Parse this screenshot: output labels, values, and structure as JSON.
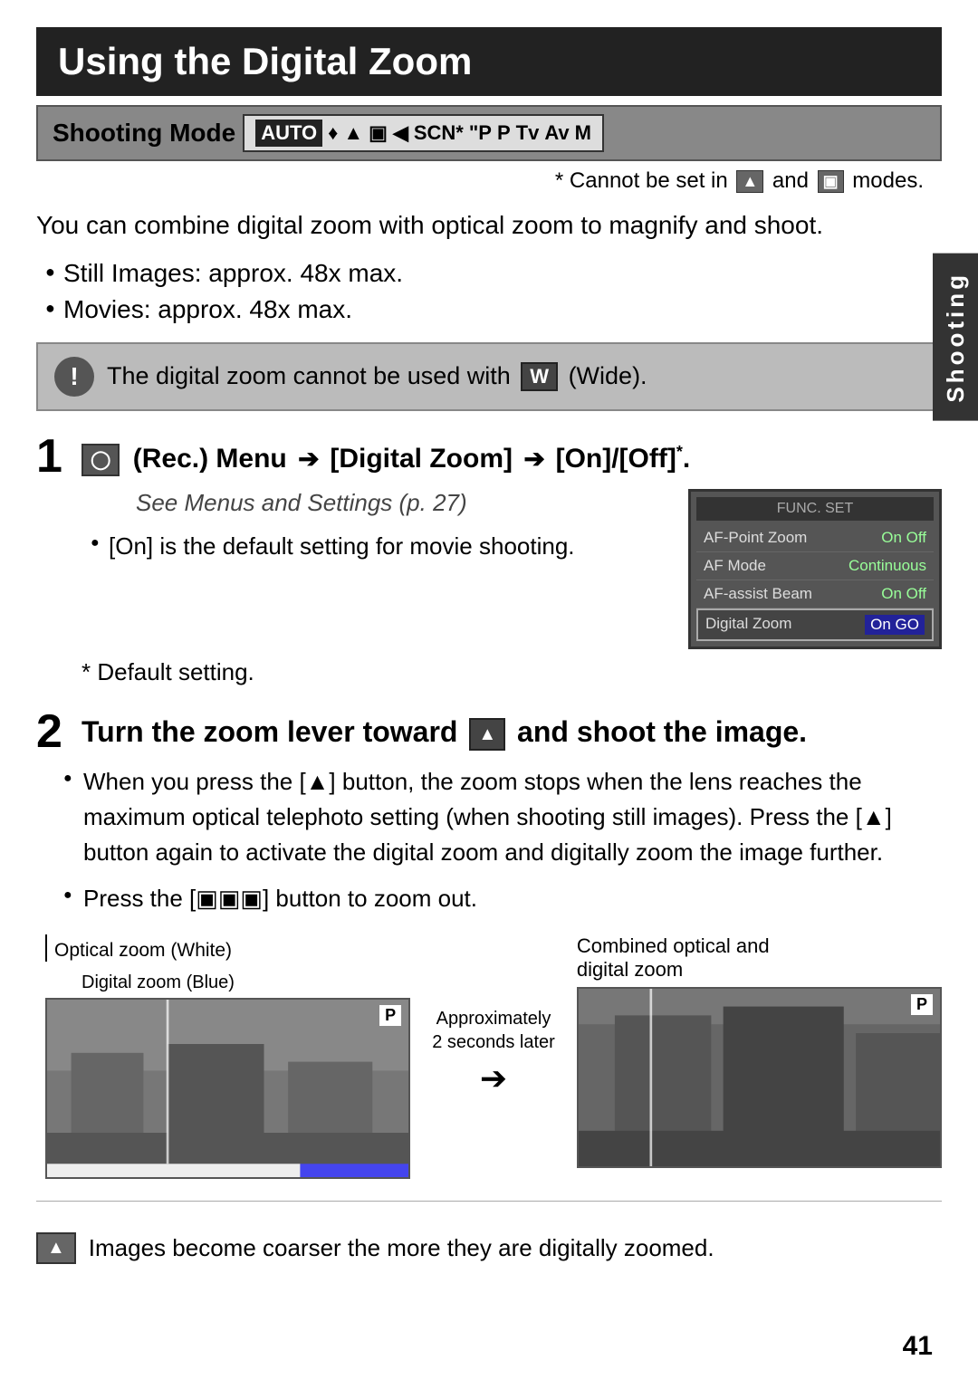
{
  "page": {
    "title": "Using the Digital Zoom",
    "page_number": "41"
  },
  "shooting_mode": {
    "label": "Shooting Mode",
    "icons": [
      "AUTO",
      "♦",
      "▲",
      "▣",
      "◀",
      "SCN*",
      "\"P",
      "P",
      "Tv",
      "Av",
      "M"
    ]
  },
  "cannot_set_note": "* Cannot be set in",
  "cannot_set_and": "and",
  "cannot_set_modes": "modes.",
  "intro": {
    "text": "You can combine digital zoom with optical zoom to magnify and shoot.",
    "bullets": [
      "Still Images: approx. 48x max.",
      "Movies: approx. 48x max."
    ]
  },
  "warning": {
    "text": "The digital zoom cannot be used with",
    "wide_label": "W",
    "wide_paren": "(Wide)."
  },
  "step1": {
    "number": "1",
    "rec_icon": "o",
    "title_part1": "(Rec.) Menu",
    "arrow1": "➔",
    "title_part2": "[Digital Zoom]",
    "arrow2": "➔",
    "title_part3": "[On]/[Off]",
    "superscript": "*",
    "subtitle": "See Menus and Settings (p. 27)",
    "bullets": [
      "[On] is the default setting for movie shooting."
    ],
    "camera_screen": {
      "header": "FUNC. SET",
      "rows": [
        {
          "label": "AF-Point Zoom",
          "value": "On Off"
        },
        {
          "label": "AF Mode",
          "value": "Continuous"
        },
        {
          "label": "AF-assist Beam",
          "value": "On Off"
        },
        {
          "label": "Digital Zoom",
          "value": "On GO",
          "active": true
        }
      ]
    },
    "default_note": "* Default setting."
  },
  "step2": {
    "number": "2",
    "title_part1": "Turn the zoom lever toward",
    "tele_icon": "▲",
    "title_part2": "and shoot the image.",
    "bullets": [
      "When you press the [▲] button, the zoom stops when the lens reaches the maximum optical telephoto setting (when shooting still images). Press the [▲] button again to activate the digital zoom and digitally zoom the image further.",
      "Press the [▣▣▣] button to zoom out."
    ],
    "zoom_diagram": {
      "left_label": "Optical zoom (White)",
      "center_label": "Digital zoom (Blue)",
      "approx_text": "Approximately\n2 seconds later",
      "right_label": "Combined optical and\ndigital zoom"
    }
  },
  "divider": true,
  "bottom_note": {
    "icon": "▲",
    "text": "Images become coarser the more they are digitally zoomed."
  },
  "sidebar": {
    "label": "Shooting"
  }
}
